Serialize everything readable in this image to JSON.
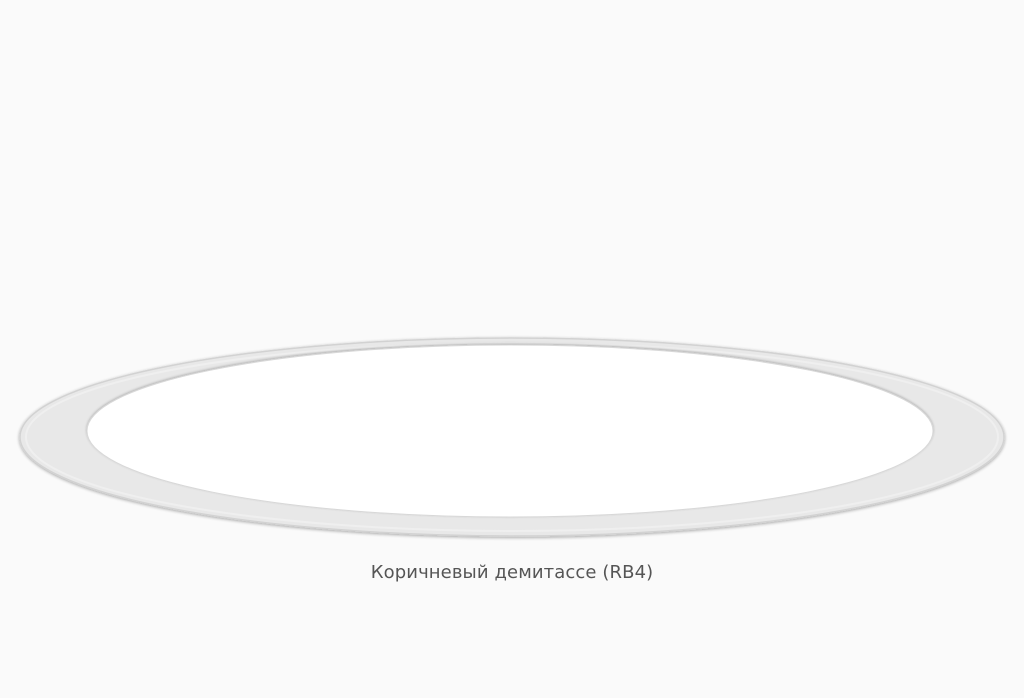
{
  "product": {
    "caption": "Коричневый демитассе (RB4)"
  },
  "colors": {
    "background": "#fafafa",
    "plate_rim": "#e8e8e8",
    "plate_rim_edge": "#d2d2d2",
    "plate_center": "#ffffff",
    "caption_text": "#555555"
  }
}
